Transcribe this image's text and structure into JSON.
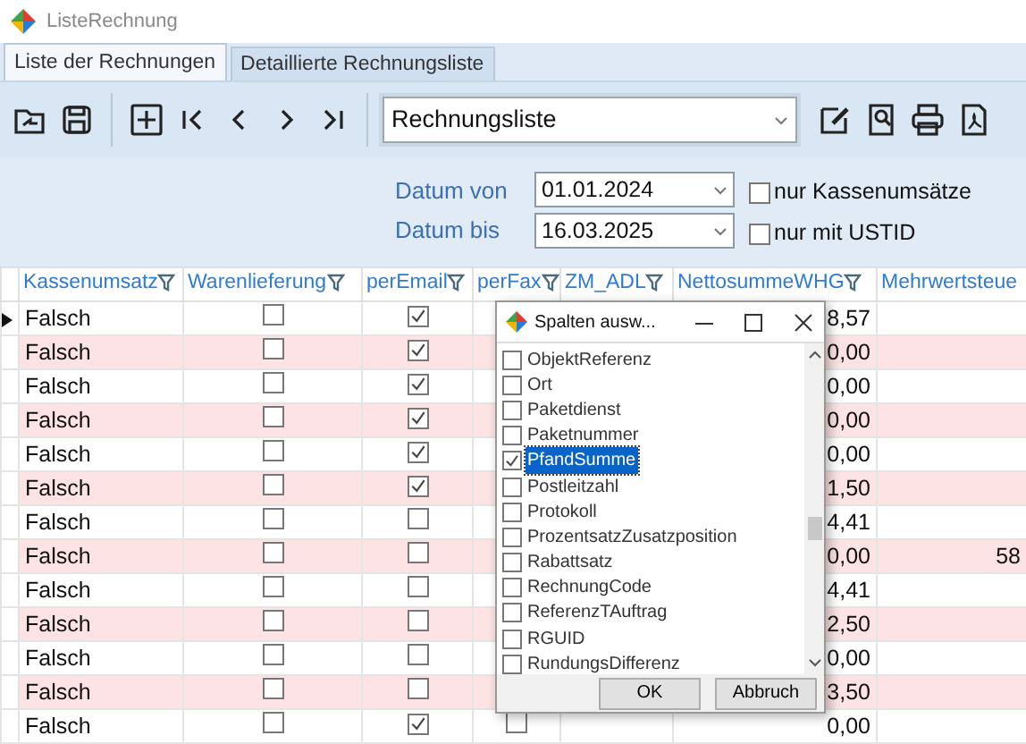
{
  "window": {
    "title": "ListeRechnung"
  },
  "tabs": [
    {
      "label": "Liste der Rechnungen",
      "selected": true
    },
    {
      "label": "Detaillierte Rechnungsliste",
      "selected": false
    }
  ],
  "toolbar": {
    "report_select": {
      "value": "Rechnungsliste"
    }
  },
  "filters": {
    "dates": [
      {
        "label": "Datum von",
        "value": "01.01.2024"
      },
      {
        "label": "Datum bis",
        "value": "16.03.2025"
      }
    ],
    "checkboxes": [
      {
        "label": "nur Kassenumsätze",
        "checked": false
      },
      {
        "label": "nur mit USTID",
        "checked": false
      }
    ]
  },
  "grid": {
    "columns": [
      "Kassenumsatz",
      "Warenlieferung",
      "perEmail",
      "perFax",
      "ZM_ADL",
      "NettosummeWHG",
      "Mehrwertsteue"
    ],
    "rows": [
      {
        "current": true,
        "kassenumsatz": "Falsch",
        "warenlieferung": false,
        "per_email": true,
        "nettosumme": "8,57"
      },
      {
        "current": false,
        "kassenumsatz": "Falsch",
        "warenlieferung": false,
        "per_email": true,
        "nettosumme": "0,00"
      },
      {
        "current": false,
        "kassenumsatz": "Falsch",
        "warenlieferung": false,
        "per_email": true,
        "nettosumme": "0,00"
      },
      {
        "current": false,
        "kassenumsatz": "Falsch",
        "warenlieferung": false,
        "per_email": true,
        "nettosumme": "0,00"
      },
      {
        "current": false,
        "kassenumsatz": "Falsch",
        "warenlieferung": false,
        "per_email": true,
        "nettosumme": "0,00"
      },
      {
        "current": false,
        "kassenumsatz": "Falsch",
        "warenlieferung": false,
        "per_email": true,
        "nettosumme": "1,50"
      },
      {
        "current": false,
        "kassenumsatz": "Falsch",
        "warenlieferung": false,
        "per_email": false,
        "nettosumme": "4,41"
      },
      {
        "current": false,
        "kassenumsatz": "Falsch",
        "warenlieferung": false,
        "per_email": false,
        "nettosumme": "0,00",
        "mehrwertsteuer": "58"
      },
      {
        "current": false,
        "kassenumsatz": "Falsch",
        "warenlieferung": false,
        "per_email": false,
        "nettosumme": "4,41"
      },
      {
        "current": false,
        "kassenumsatz": "Falsch",
        "warenlieferung": false,
        "per_email": false,
        "nettosumme": "2,50"
      },
      {
        "current": false,
        "kassenumsatz": "Falsch",
        "warenlieferung": false,
        "per_email": false,
        "nettosumme": "0,00"
      },
      {
        "current": false,
        "kassenumsatz": "Falsch",
        "warenlieferung": false,
        "per_email": false,
        "nettosumme": "3,50"
      },
      {
        "current": false,
        "kassenumsatz": "Falsch",
        "warenlieferung": false,
        "per_email": true,
        "per_fax": false,
        "nettosumme": "0,00"
      }
    ]
  },
  "dialog": {
    "title": "Spalten ausw...",
    "items": [
      {
        "label": "ObjektReferenz",
        "checked": false,
        "selected": false
      },
      {
        "label": "Ort",
        "checked": false,
        "selected": false
      },
      {
        "label": "Paketdienst",
        "checked": false,
        "selected": false
      },
      {
        "label": "Paketnummer",
        "checked": false,
        "selected": false
      },
      {
        "label": "PfandSumme",
        "checked": true,
        "selected": true
      },
      {
        "label": "Postleitzahl",
        "checked": false,
        "selected": false
      },
      {
        "label": "Protokoll",
        "checked": false,
        "selected": false
      },
      {
        "label": "ProzentsatzZusatzposition",
        "checked": false,
        "selected": false
      },
      {
        "label": "Rabattsatz",
        "checked": false,
        "selected": false
      },
      {
        "label": "RechnungCode",
        "checked": false,
        "selected": false
      },
      {
        "label": "ReferenzTAuftrag",
        "checked": false,
        "selected": false
      },
      {
        "label": "RGUID",
        "checked": false,
        "selected": false
      },
      {
        "label": "RundungsDifferenz",
        "checked": false,
        "selected": false
      }
    ],
    "buttons": [
      "OK",
      "Abbruch"
    ]
  }
}
